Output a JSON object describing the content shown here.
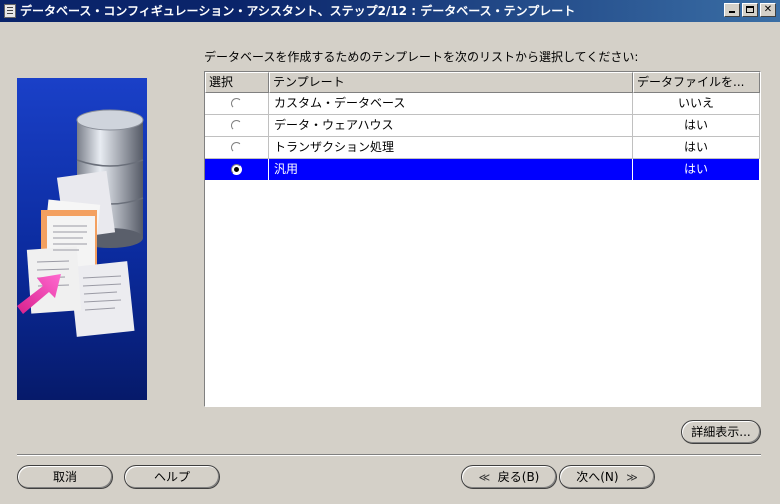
{
  "window": {
    "title": "データベース・コンフィギュレーション・アシスタント、ステップ2/12 : データベース・テンプレート",
    "minimize_label": "",
    "maximize_label": "",
    "close_label": "✕"
  },
  "intro_text": "データベースを作成するためのテンプレートを次のリストから選択してください:",
  "table": {
    "headers": [
      "選択",
      "テンプレート",
      "データファイルを..."
    ],
    "rows": [
      {
        "template": "カスタム・データベース",
        "datafiles": "いいえ",
        "selected": false
      },
      {
        "template": "データ・ウェアハウス",
        "datafiles": "はい",
        "selected": false
      },
      {
        "template": "トランザクション処理",
        "datafiles": "はい",
        "selected": false
      },
      {
        "template": "汎用",
        "datafiles": "はい",
        "selected": true
      }
    ]
  },
  "buttons": {
    "details": "詳細表示...",
    "cancel": "取消",
    "help": "ヘルプ",
    "back": "戻る(B)",
    "next": "次へ(N)"
  },
  "colors": {
    "selection": "#0000ff",
    "title_bar": "#0a246a",
    "dialog_bg": "#d4d0c8"
  }
}
